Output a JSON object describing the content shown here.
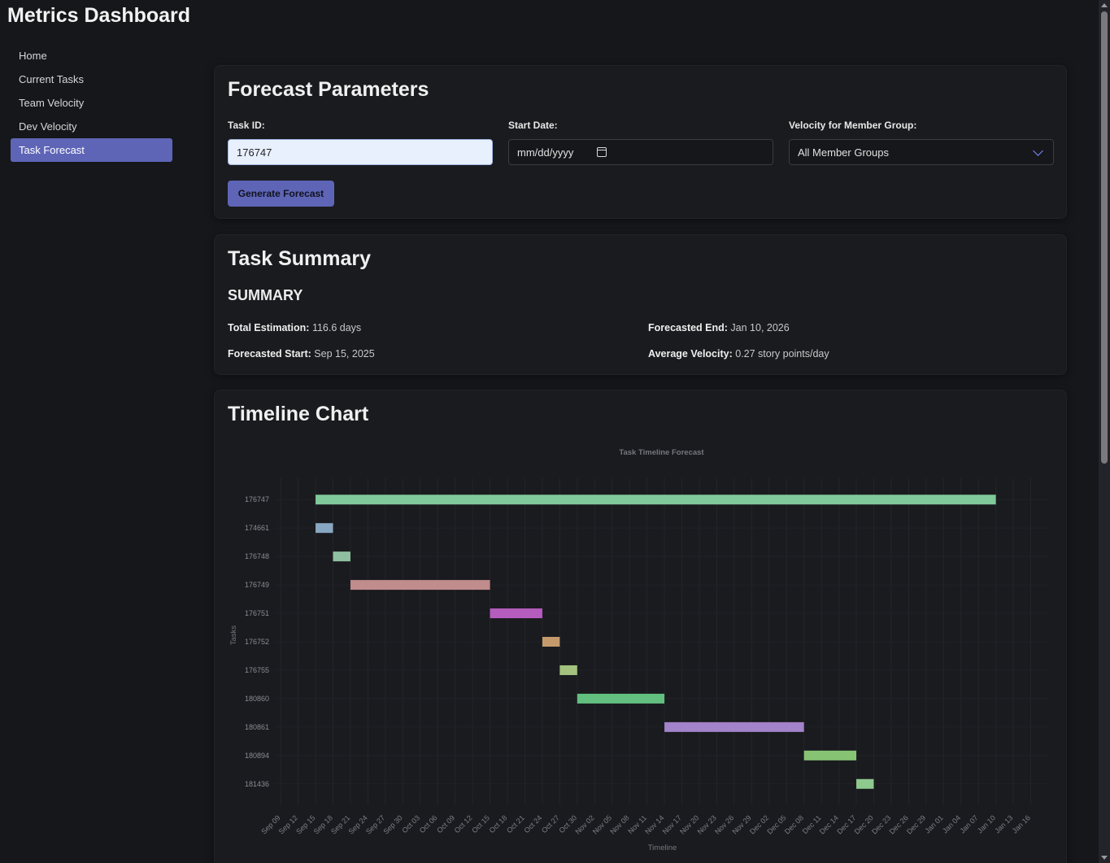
{
  "app": {
    "title": "Metrics Dashboard"
  },
  "sidebar": {
    "items": [
      {
        "label": "Home",
        "active": false
      },
      {
        "label": "Current Tasks",
        "active": false
      },
      {
        "label": "Team Velocity",
        "active": false
      },
      {
        "label": "Dev Velocity",
        "active": false
      },
      {
        "label": "Task Forecast",
        "active": true
      }
    ]
  },
  "forecast_params": {
    "title": "Forecast Parameters",
    "task_id_label": "Task ID:",
    "task_id_value": "176747",
    "start_date_label": "Start Date:",
    "start_date_placeholder": "mm/dd/yyyy",
    "velocity_label": "Velocity for Member Group:",
    "velocity_value": "All Member Groups",
    "generate_button": "Generate Forecast"
  },
  "task_summary": {
    "title": "Task Summary",
    "subtitle": "SUMMARY",
    "total_estimation_label": "Total Estimation:",
    "total_estimation_value": "116.6 days",
    "forecasted_start_label": "Forecasted Start:",
    "forecasted_start_value": "Sep 15, 2025",
    "forecasted_end_label": "Forecasted End:",
    "forecasted_end_value": "Jan 10, 2026",
    "avg_velocity_label": "Average Velocity:",
    "avg_velocity_value": "0.27 story points/day"
  },
  "timeline": {
    "title": "Timeline Chart"
  },
  "chart_data": {
    "type": "bar",
    "subtype": "gantt-horizontal",
    "title": "Task Timeline Forecast",
    "xlabel": "Timeline",
    "ylabel": "Tasks",
    "grid": true,
    "xlim": [
      "2025-09-08",
      "2026-01-19"
    ],
    "xticks": [
      "Sep 09",
      "Sep 12",
      "Sep 15",
      "Sep 18",
      "Sep 21",
      "Sep 24",
      "Sep 27",
      "Sep 30",
      "Oct 03",
      "Oct 06",
      "Oct 09",
      "Oct 12",
      "Oct 15",
      "Oct 18",
      "Oct 21",
      "Oct 24",
      "Oct 27",
      "Oct 30",
      "Nov 02",
      "Nov 05",
      "Nov 08",
      "Nov 11",
      "Nov 14",
      "Nov 17",
      "Nov 20",
      "Nov 23",
      "Nov 26",
      "Nov 29",
      "Dec 02",
      "Dec 05",
      "Dec 08",
      "Dec 11",
      "Dec 14",
      "Dec 17",
      "Dec 20",
      "Dec 23",
      "Dec 26",
      "Dec 29",
      "Jan 01",
      "Jan 04",
      "Jan 07",
      "Jan 10",
      "Jan 13",
      "Jan 16"
    ],
    "xtick_dates": [
      "2025-09-09",
      "2025-09-12",
      "2025-09-15",
      "2025-09-18",
      "2025-09-21",
      "2025-09-24",
      "2025-09-27",
      "2025-09-30",
      "2025-10-03",
      "2025-10-06",
      "2025-10-09",
      "2025-10-12",
      "2025-10-15",
      "2025-10-18",
      "2025-10-21",
      "2025-10-24",
      "2025-10-27",
      "2025-10-30",
      "2025-11-02",
      "2025-11-05",
      "2025-11-08",
      "2025-11-11",
      "2025-11-14",
      "2025-11-17",
      "2025-11-20",
      "2025-11-23",
      "2025-11-26",
      "2025-11-29",
      "2025-12-02",
      "2025-12-05",
      "2025-12-08",
      "2025-12-11",
      "2025-12-14",
      "2025-12-17",
      "2025-12-20",
      "2025-12-23",
      "2025-12-26",
      "2025-12-29",
      "2026-01-01",
      "2026-01-04",
      "2026-01-07",
      "2026-01-10",
      "2026-01-13",
      "2026-01-16"
    ],
    "tasks": [
      {
        "id": "176747",
        "start": "2025-09-15",
        "end": "2026-01-10",
        "color": "#7fc99a"
      },
      {
        "id": "174661",
        "start": "2025-09-15",
        "end": "2025-09-18",
        "color": "#88a7c2"
      },
      {
        "id": "176748",
        "start": "2025-09-18",
        "end": "2025-09-21",
        "color": "#8fbfa0"
      },
      {
        "id": "176749",
        "start": "2025-09-21",
        "end": "2025-10-15",
        "color": "#c08c8c"
      },
      {
        "id": "176751",
        "start": "2025-10-15",
        "end": "2025-10-24",
        "color": "#b55cbf"
      },
      {
        "id": "176752",
        "start": "2025-10-24",
        "end": "2025-10-27",
        "color": "#c49a6c"
      },
      {
        "id": "176755",
        "start": "2025-10-27",
        "end": "2025-10-30",
        "color": "#a4c27e"
      },
      {
        "id": "180860",
        "start": "2025-10-30",
        "end": "2025-11-14",
        "color": "#62bf7f"
      },
      {
        "id": "180861",
        "start": "2025-11-14",
        "end": "2025-12-08",
        "color": "#a383c9"
      },
      {
        "id": "180894",
        "start": "2025-12-08",
        "end": "2025-12-17",
        "color": "#86c474"
      },
      {
        "id": "181436",
        "start": "2025-12-17",
        "end": "2025-12-20",
        "color": "#8ec98e"
      }
    ]
  }
}
